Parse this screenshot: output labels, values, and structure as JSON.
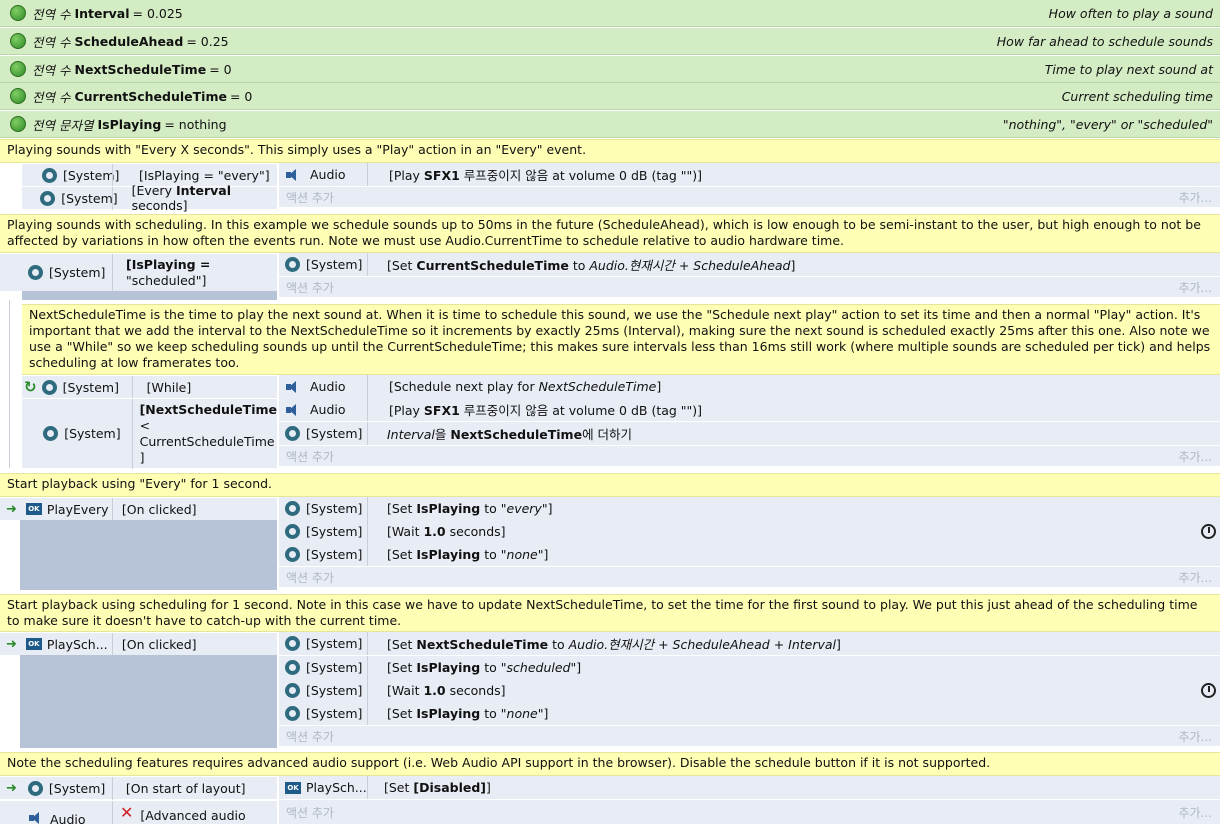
{
  "globals": [
    {
      "kw": "전역 수",
      "name": "Interval",
      "val": "= 0.025",
      "comment": "How often to play a sound"
    },
    {
      "kw": "전역 수",
      "name": "ScheduleAhead",
      "val": "= 0.25",
      "comment": "How far ahead to schedule sounds"
    },
    {
      "kw": "전역 수",
      "name": "NextScheduleTime",
      "val": "= 0",
      "comment": "Time to play next sound at"
    },
    {
      "kw": "전역 수",
      "name": "CurrentScheduleTime",
      "val": "= 0",
      "comment": "Current scheduling time"
    },
    {
      "kw": "전역 문자열",
      "name": "IsPlaying",
      "val": "= nothing",
      "comment": "\"nothing\", \"every\" or \"scheduled\""
    }
  ],
  "comments": {
    "c1": "Playing sounds with \"Every X seconds\". This simply uses a \"Play\" action in an \"Every\" event.",
    "c2": "Playing sounds with scheduling. In this example we schedule sounds up to 50ms in the future (ScheduleAhead), which is low enough to be semi-instant to the user, but high enough to not be affected by variations in how often the events run. Note we must use Audio.CurrentTime to schedule relative to audio hardware time.",
    "c3": "NextScheduleTime is the time to play the next sound at. When it is time to schedule this sound, we use the \"Schedule next play\" action to set its time and then a normal \"Play\" action. It's important that we add the interval to the NextScheduleTime so it increments by exactly 25ms (Interval), making sure the next sound is scheduled exactly 25ms after this one. Also note we use a \"While\" so we keep scheduling sounds up until the CurrentScheduleTime; this makes sure intervals less than 16ms still work (where multiple sounds are scheduled per tick) and helps scheduling at low framerates too.",
    "c4": "Start playback using \"Every\" for 1 second.",
    "c5": "Start playback using scheduling for 1 second. Note in this case we have to update NextScheduleTime, to set the time for the first sound to play. We put this just ahead of the scheduling time to make sure it doesn't have to catch-up with the current time.",
    "c6": "Note the scheduling features requires advanced audio support (i.e. Web Audio API support in the browser). Disable the schedule button if it is not supported."
  },
  "labels": {
    "system": "[System]",
    "audio": "Audio",
    "add_action": "액션 추가",
    "add_more": "추가...",
    "playevery": "PlayEvery",
    "playsch": "PlaySch...",
    "on_clicked": "[On clicked]",
    "on_start": "[On start of layout]",
    "while": "[While]",
    "adv_audio": "[Advanced audio",
    "ok": "OK"
  },
  "e1": {
    "c1": "[IsPlaying = \"every\"]",
    "c2a": "[Every ",
    "c2b": "Interval",
    "c2c": " seconds]",
    "a1a": "[Play ",
    "a1b": "SFX1",
    "a1c": " 루프중이지 않음 at volume 0 dB (tag \"\")]"
  },
  "e2": {
    "c1a": "[IsPlaying =",
    "c1b": "\"scheduled\"]",
    "a1a": "[Set ",
    "a1b": "CurrentScheduleTime",
    "a1c": " to ",
    "a1d": "Audio.현재시간 + ScheduleAhead",
    "a1e": "]"
  },
  "e3": {
    "c2a": "[NextScheduleTime",
    "c2b": "<",
    "c2c": "CurrentScheduleTime",
    "c2d": "]",
    "a1a": "[Schedule next play for ",
    "a1b": "NextScheduleTime",
    "a1c": "]",
    "a2a": "[Play ",
    "a2b": "SFX1",
    "a2c": " 루프중이지 않음 at volume 0 dB (tag \"\")]",
    "a3a": "Interval",
    "a3b": "을 ",
    "a3c": "NextScheduleTime",
    "a3d": "에 더하기"
  },
  "e4": {
    "a1a": "[Set ",
    "a1b": "IsPlaying",
    "a1c": " to ",
    "a1d": "\"every\"",
    "a1e": "]",
    "a2a": "[Wait ",
    "a2b": "1.0",
    "a2c": " seconds]",
    "a3a": "[Set ",
    "a3b": "IsPlaying",
    "a3c": " to ",
    "a3d": "\"none\"",
    "a3e": "]"
  },
  "e5": {
    "a1a": "[Set ",
    "a1b": "NextScheduleTime",
    "a1c": " to ",
    "a1d": "Audio.현재시간 + ScheduleAhead + Interval",
    "a1e": "]",
    "a2a": "[Set ",
    "a2b": "IsPlaying",
    "a2c": " to ",
    "a2d": "\"scheduled\"",
    "a2e": "]",
    "a3a": "[Wait ",
    "a3b": "1.0",
    "a3c": " seconds]",
    "a4a": "[Set ",
    "a4b": "IsPlaying",
    "a4c": " to ",
    "a4d": "\"none\"",
    "a4e": "]"
  },
  "e6": {
    "a1a": "[Set ",
    "a1b": "[Disabled]",
    "a1c": "]"
  }
}
